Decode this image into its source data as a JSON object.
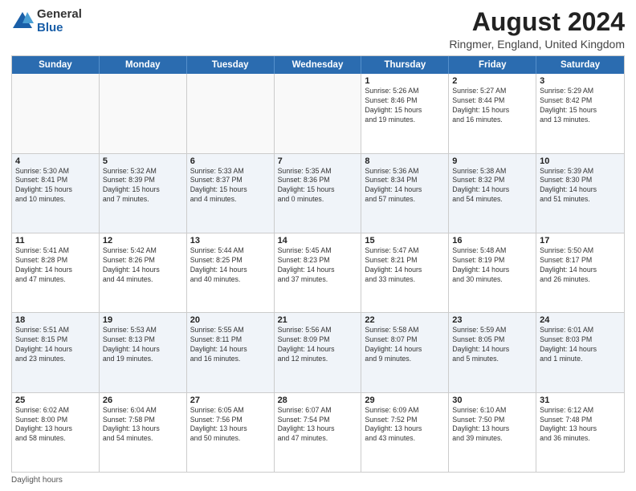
{
  "logo": {
    "general": "General",
    "blue": "Blue"
  },
  "title": "August 2024",
  "subtitle": "Ringmer, England, United Kingdom",
  "days_of_week": [
    "Sunday",
    "Monday",
    "Tuesday",
    "Wednesday",
    "Thursday",
    "Friday",
    "Saturday"
  ],
  "footer": "Daylight hours",
  "weeks": [
    [
      {
        "day": "",
        "text": "",
        "empty": true
      },
      {
        "day": "",
        "text": "",
        "empty": true
      },
      {
        "day": "",
        "text": "",
        "empty": true
      },
      {
        "day": "",
        "text": "",
        "empty": true
      },
      {
        "day": "1",
        "text": "Sunrise: 5:26 AM\nSunset: 8:46 PM\nDaylight: 15 hours\nand 19 minutes.",
        "empty": false
      },
      {
        "day": "2",
        "text": "Sunrise: 5:27 AM\nSunset: 8:44 PM\nDaylight: 15 hours\nand 16 minutes.",
        "empty": false
      },
      {
        "day": "3",
        "text": "Sunrise: 5:29 AM\nSunset: 8:42 PM\nDaylight: 15 hours\nand 13 minutes.",
        "empty": false
      }
    ],
    [
      {
        "day": "4",
        "text": "Sunrise: 5:30 AM\nSunset: 8:41 PM\nDaylight: 15 hours\nand 10 minutes.",
        "empty": false,
        "alt": true
      },
      {
        "day": "5",
        "text": "Sunrise: 5:32 AM\nSunset: 8:39 PM\nDaylight: 15 hours\nand 7 minutes.",
        "empty": false,
        "alt": true
      },
      {
        "day": "6",
        "text": "Sunrise: 5:33 AM\nSunset: 8:37 PM\nDaylight: 15 hours\nand 4 minutes.",
        "empty": false,
        "alt": true
      },
      {
        "day": "7",
        "text": "Sunrise: 5:35 AM\nSunset: 8:36 PM\nDaylight: 15 hours\nand 0 minutes.",
        "empty": false,
        "alt": true
      },
      {
        "day": "8",
        "text": "Sunrise: 5:36 AM\nSunset: 8:34 PM\nDaylight: 14 hours\nand 57 minutes.",
        "empty": false,
        "alt": true
      },
      {
        "day": "9",
        "text": "Sunrise: 5:38 AM\nSunset: 8:32 PM\nDaylight: 14 hours\nand 54 minutes.",
        "empty": false,
        "alt": true
      },
      {
        "day": "10",
        "text": "Sunrise: 5:39 AM\nSunset: 8:30 PM\nDaylight: 14 hours\nand 51 minutes.",
        "empty": false,
        "alt": true
      }
    ],
    [
      {
        "day": "11",
        "text": "Sunrise: 5:41 AM\nSunset: 8:28 PM\nDaylight: 14 hours\nand 47 minutes.",
        "empty": false
      },
      {
        "day": "12",
        "text": "Sunrise: 5:42 AM\nSunset: 8:26 PM\nDaylight: 14 hours\nand 44 minutes.",
        "empty": false
      },
      {
        "day": "13",
        "text": "Sunrise: 5:44 AM\nSunset: 8:25 PM\nDaylight: 14 hours\nand 40 minutes.",
        "empty": false
      },
      {
        "day": "14",
        "text": "Sunrise: 5:45 AM\nSunset: 8:23 PM\nDaylight: 14 hours\nand 37 minutes.",
        "empty": false
      },
      {
        "day": "15",
        "text": "Sunrise: 5:47 AM\nSunset: 8:21 PM\nDaylight: 14 hours\nand 33 minutes.",
        "empty": false
      },
      {
        "day": "16",
        "text": "Sunrise: 5:48 AM\nSunset: 8:19 PM\nDaylight: 14 hours\nand 30 minutes.",
        "empty": false
      },
      {
        "day": "17",
        "text": "Sunrise: 5:50 AM\nSunset: 8:17 PM\nDaylight: 14 hours\nand 26 minutes.",
        "empty": false
      }
    ],
    [
      {
        "day": "18",
        "text": "Sunrise: 5:51 AM\nSunset: 8:15 PM\nDaylight: 14 hours\nand 23 minutes.",
        "empty": false,
        "alt": true
      },
      {
        "day": "19",
        "text": "Sunrise: 5:53 AM\nSunset: 8:13 PM\nDaylight: 14 hours\nand 19 minutes.",
        "empty": false,
        "alt": true
      },
      {
        "day": "20",
        "text": "Sunrise: 5:55 AM\nSunset: 8:11 PM\nDaylight: 14 hours\nand 16 minutes.",
        "empty": false,
        "alt": true
      },
      {
        "day": "21",
        "text": "Sunrise: 5:56 AM\nSunset: 8:09 PM\nDaylight: 14 hours\nand 12 minutes.",
        "empty": false,
        "alt": true
      },
      {
        "day": "22",
        "text": "Sunrise: 5:58 AM\nSunset: 8:07 PM\nDaylight: 14 hours\nand 9 minutes.",
        "empty": false,
        "alt": true
      },
      {
        "day": "23",
        "text": "Sunrise: 5:59 AM\nSunset: 8:05 PM\nDaylight: 14 hours\nand 5 minutes.",
        "empty": false,
        "alt": true
      },
      {
        "day": "24",
        "text": "Sunrise: 6:01 AM\nSunset: 8:03 PM\nDaylight: 14 hours\nand 1 minute.",
        "empty": false,
        "alt": true
      }
    ],
    [
      {
        "day": "25",
        "text": "Sunrise: 6:02 AM\nSunset: 8:00 PM\nDaylight: 13 hours\nand 58 minutes.",
        "empty": false
      },
      {
        "day": "26",
        "text": "Sunrise: 6:04 AM\nSunset: 7:58 PM\nDaylight: 13 hours\nand 54 minutes.",
        "empty": false
      },
      {
        "day": "27",
        "text": "Sunrise: 6:05 AM\nSunset: 7:56 PM\nDaylight: 13 hours\nand 50 minutes.",
        "empty": false
      },
      {
        "day": "28",
        "text": "Sunrise: 6:07 AM\nSunset: 7:54 PM\nDaylight: 13 hours\nand 47 minutes.",
        "empty": false
      },
      {
        "day": "29",
        "text": "Sunrise: 6:09 AM\nSunset: 7:52 PM\nDaylight: 13 hours\nand 43 minutes.",
        "empty": false
      },
      {
        "day": "30",
        "text": "Sunrise: 6:10 AM\nSunset: 7:50 PM\nDaylight: 13 hours\nand 39 minutes.",
        "empty": false
      },
      {
        "day": "31",
        "text": "Sunrise: 6:12 AM\nSunset: 7:48 PM\nDaylight: 13 hours\nand 36 minutes.",
        "empty": false
      }
    ]
  ]
}
